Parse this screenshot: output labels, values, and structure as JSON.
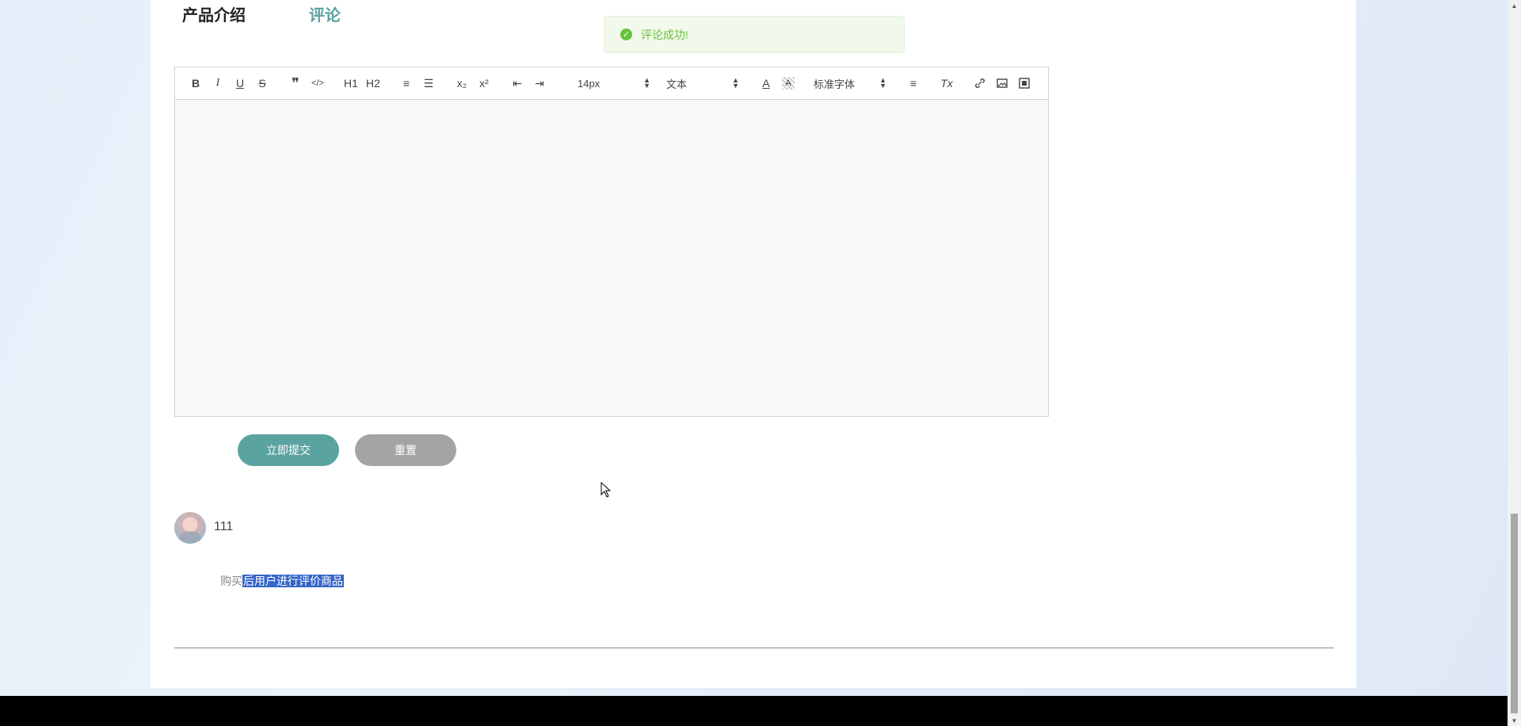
{
  "tabs": [
    "产品介绍",
    "评论"
  ],
  "toast": {
    "message": "评论成功!",
    "icon": "success-check-icon",
    "color": "#67c23a"
  },
  "editor": {
    "toolbar": {
      "bold": "B",
      "italic": "I",
      "underline": "U",
      "strike": "S",
      "blockquote": "❞",
      "code": "</>",
      "h1": "H1",
      "h2": "H2",
      "ordered_list": "≡",
      "bullet_list": "☰",
      "subscript": "x₂",
      "superscript": "x²",
      "outdent": "⇤",
      "indent": "⇥",
      "font_size": "14px",
      "header_select": "文本",
      "font_color": "A",
      "background_color": "A",
      "font_family": "标准字体",
      "align": "≡",
      "clean": "Tx"
    }
  },
  "buttons": {
    "submit": "立即提交",
    "reset": "重置"
  },
  "accent_color": "#5ba3a0",
  "comment": {
    "username": "111",
    "text_plain": "购买",
    "text_selected": "后用户进行评价商品"
  }
}
